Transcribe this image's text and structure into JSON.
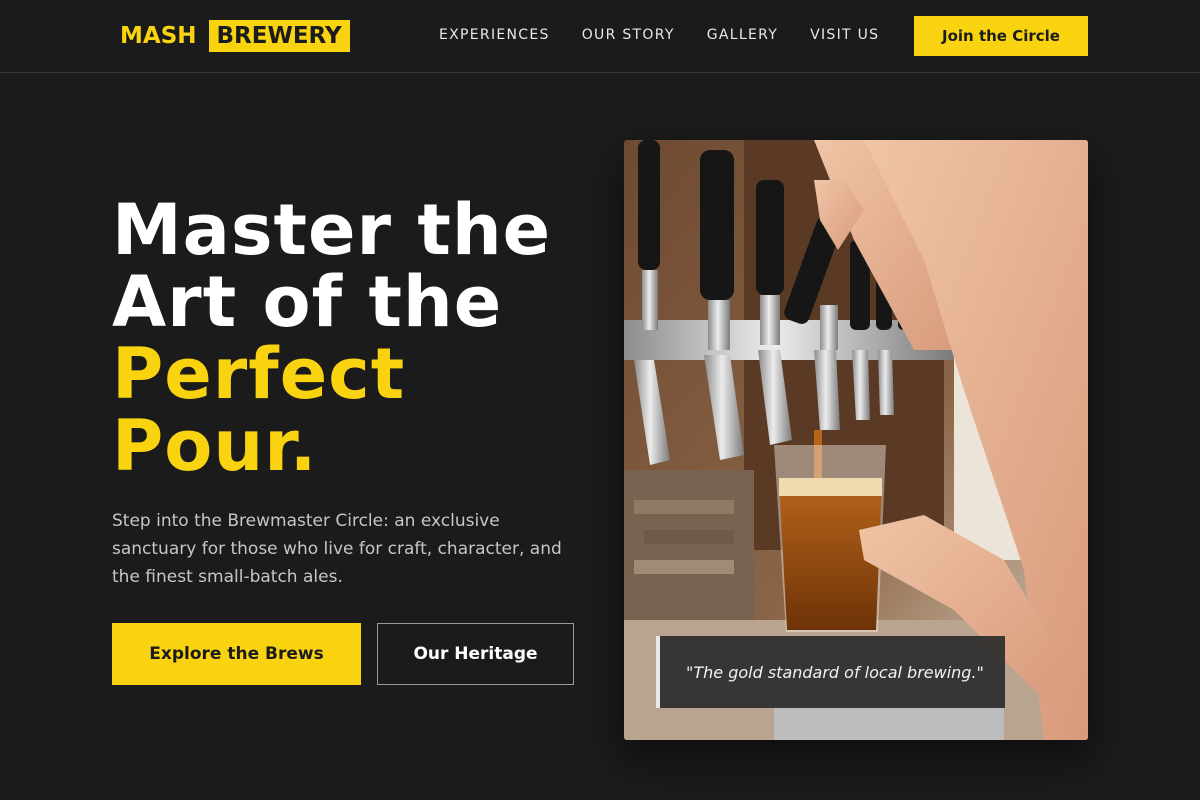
{
  "brand": {
    "first": "MASH",
    "second": "BREWERY"
  },
  "nav": [
    {
      "label": "EXPERIENCES"
    },
    {
      "label": "OUR STORY"
    },
    {
      "label": "GALLERY"
    },
    {
      "label": "VISIT US"
    }
  ],
  "header_cta": "Join the Circle",
  "hero": {
    "line1": "Master the",
    "line2": "Art of the",
    "line3": "Perfect",
    "line4": "Pour.",
    "description": "Step into the Brewmaster Circle: an exclusive sanctuary for those who live for craft, character, and the finest small-batch ales.",
    "primary_button": "Explore the Brews",
    "secondary_button": "Our Heritage"
  },
  "photo": {
    "quote": "\"The gold standard of local brewing.\""
  },
  "colors": {
    "accent": "#f9d30f",
    "background": "#1b1b1b"
  }
}
